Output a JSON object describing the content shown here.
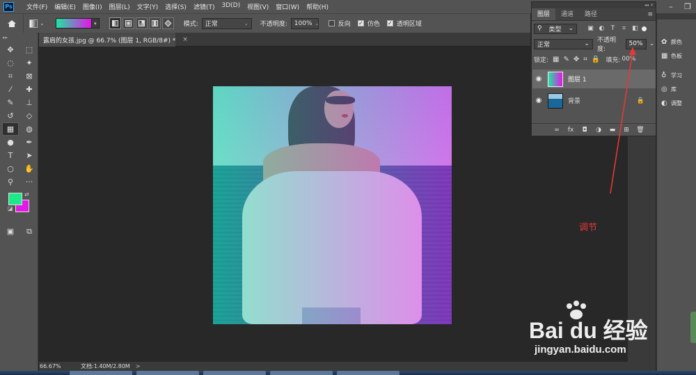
{
  "menubar": {
    "logo": "Ps",
    "items": [
      "文件(F)",
      "编辑(E)",
      "图像(I)",
      "图层(L)",
      "文字(Y)",
      "选择(S)",
      "滤镜(T)",
      "3D(D)",
      "视图(V)",
      "窗口(W)",
      "帮助(H)"
    ]
  },
  "options": {
    "mode_label": "模式:",
    "mode_value": "正常",
    "opacity_label": "不透明度:",
    "opacity_value": "100%",
    "reverse_label": "反向",
    "dither_label": "仿色",
    "transparency_label": "透明区域",
    "reverse_checked": false,
    "dither_checked": true,
    "transparency_checked": true
  },
  "colors": {
    "gradient_start": "#1ee6a0",
    "gradient_end": "#e613e8",
    "foreground": "#1de98b",
    "background": "#e31ae6",
    "annotation": "#e53935"
  },
  "document": {
    "tab_title": "露肩的女孩.jpg @ 66.7% (图层 1, RGB/8#) *",
    "tab_close": "×"
  },
  "status": {
    "zoom": "66.67%",
    "doc_info": "文档:1.40M/2.80M",
    "arrow": ">"
  },
  "layers_panel": {
    "tabs": [
      "图层",
      "通道",
      "路径"
    ],
    "filter_value": "类型",
    "blend_value": "正常",
    "opacity_label": "不透明度:",
    "opacity_value": "50%",
    "lock_label": "锁定:",
    "fill_label": "填充:",
    "fill_value": "00%",
    "layers": [
      {
        "name": "图层 1",
        "selected": true,
        "visible": true
      },
      {
        "name": "背景",
        "selected": false,
        "visible": true,
        "locked": true
      }
    ]
  },
  "right_panels": {
    "group1": [
      "颜色",
      "色板"
    ],
    "group2": [
      "学习",
      "库",
      "调整"
    ]
  },
  "annotation": {
    "label": "调节"
  },
  "watermark": {
    "brand": "Bai du 经验",
    "url": "jingyan.baidu.com"
  }
}
